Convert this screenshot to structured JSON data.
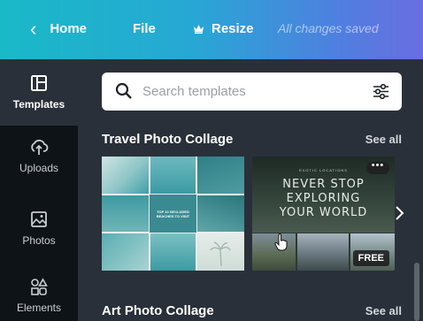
{
  "topbar": {
    "home_label": "Home",
    "file_label": "File",
    "resize_label": "Resize",
    "save_status": "All changes saved"
  },
  "sidebar": {
    "items": [
      {
        "label": "Templates",
        "icon": "layout-icon",
        "active": true
      },
      {
        "label": "Uploads",
        "icon": "upload-cloud-icon",
        "active": false
      },
      {
        "label": "Photos",
        "icon": "image-icon",
        "active": false
      },
      {
        "label": "Elements",
        "icon": "shapes-icon",
        "active": false
      }
    ]
  },
  "search": {
    "placeholder": "Search templates",
    "value": ""
  },
  "sections": [
    {
      "title": "Travel Photo Collage",
      "see_all": "See all",
      "templates": [
        {
          "text_lines": [
            "TOP 10 SECLUDED",
            "BEACHES TO VISIT"
          ]
        },
        {
          "small_text": "EXOTIC LOCATIONS",
          "headline": [
            "NEVER STOP",
            "EXPLORING",
            "YOUR WORLD"
          ],
          "badge": "FREE",
          "more": "•••"
        }
      ]
    },
    {
      "title": "Art Photo Collage",
      "see_all": "See all"
    }
  ],
  "colors": {
    "panel_bg": "#293039",
    "sidebar_bg": "#0e1318",
    "topbar_gradient_start": "#19b9c7",
    "topbar_gradient_end": "#6a6ee0"
  }
}
